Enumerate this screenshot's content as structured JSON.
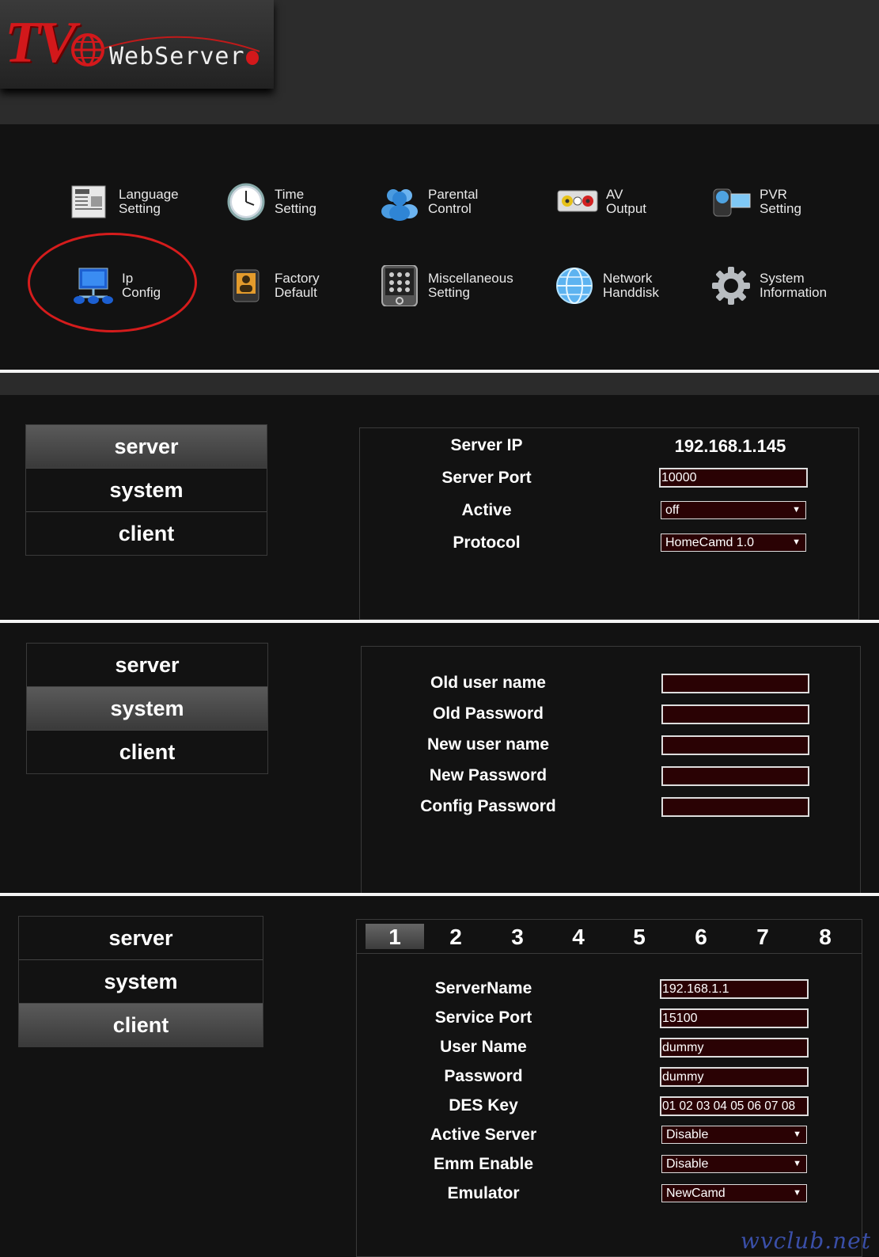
{
  "header": {
    "logo_tv": "TV",
    "logo_text": "WebServer"
  },
  "menu": {
    "items": [
      {
        "id": "language",
        "label": "Language\nSetting"
      },
      {
        "id": "time",
        "label": "Time\nSetting"
      },
      {
        "id": "parental",
        "label": "Parental\nControl"
      },
      {
        "id": "av",
        "label": "AV\nOutput"
      },
      {
        "id": "pvr",
        "label": "PVR\nSetting"
      },
      {
        "id": "ip",
        "label": "Ip\nConfig"
      },
      {
        "id": "factory",
        "label": "Factory\nDefault"
      },
      {
        "id": "misc",
        "label": "Miscellaneous\nSetting"
      },
      {
        "id": "network",
        "label": "Network\nHanddisk"
      },
      {
        "id": "system",
        "label": "System\nInformation"
      }
    ]
  },
  "tabs": {
    "server": "server",
    "system": "system",
    "client": "client"
  },
  "server_panel": {
    "server_ip_label": "Server IP",
    "server_ip_value": "192.168.1.145",
    "server_port_label": "Server Port",
    "server_port_value": "10000",
    "active_label": "Active",
    "active_value": "off",
    "protocol_label": "Protocol",
    "protocol_value": "HomeCamd 1.0"
  },
  "system_panel": {
    "old_user_label": "Old user name",
    "old_password_label": "Old Password",
    "new_user_label": "New user name",
    "new_password_label": "New Password",
    "config_password_label": "Config Password"
  },
  "client_panel": {
    "numbers": [
      "1",
      "2",
      "3",
      "4",
      "5",
      "6",
      "7",
      "8"
    ],
    "server_name_label": "ServerName",
    "server_name_value": "192.168.1.1",
    "service_port_label": "Service Port",
    "service_port_value": "15100",
    "user_name_label": "User Name",
    "user_name_value": "dummy",
    "password_label": "Password",
    "password_value": "dummy",
    "des_key_label": "DES Key",
    "des_key_value": "01 02 03 04 05 06 07 08",
    "active_server_label": "Active Server",
    "active_server_value": "Disable",
    "emm_enable_label": "Emm Enable",
    "emm_enable_value": "Disable",
    "emulator_label": "Emulator",
    "emulator_value": "NewCamd"
  },
  "watermark": "wvclub.net",
  "colors": {
    "highlight_ring": "#d51c1c",
    "input_bg": "#2a0204",
    "logo_red": "#d3181b"
  }
}
